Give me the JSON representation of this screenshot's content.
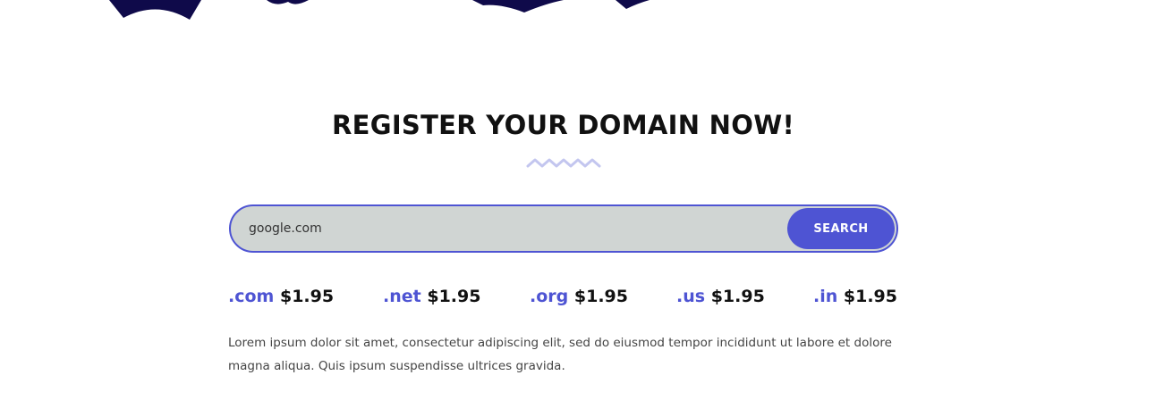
{
  "section": {
    "title": "REGISTER YOUR DOMAIN NOW!",
    "search": {
      "value": "google.com",
      "placeholder": "",
      "button_label": "SEARCH"
    },
    "prices": [
      {
        "tld": ".com",
        "price": "$1.95"
      },
      {
        "tld": ".net",
        "price": "$1.95"
      },
      {
        "tld": ".org",
        "price": "$1.95"
      },
      {
        "tld": ".us",
        "price": "$1.95"
      },
      {
        "tld": ".in",
        "price": "$1.95"
      }
    ],
    "description": "Lorem ipsum dolor sit amet, consectetur adipiscing elit, sed do eiusmod tempor incididunt ut labore et dolore magna aliqua. Quis ipsum suspendisse ultrices gravida."
  },
  "colors": {
    "accent": "#4e54d3",
    "decor": "#0f0a4a",
    "zigzag": "#c3c6ef",
    "input_bg": "#d0d5d3"
  },
  "icons": {
    "divider": "zigzag-divider-icon"
  }
}
